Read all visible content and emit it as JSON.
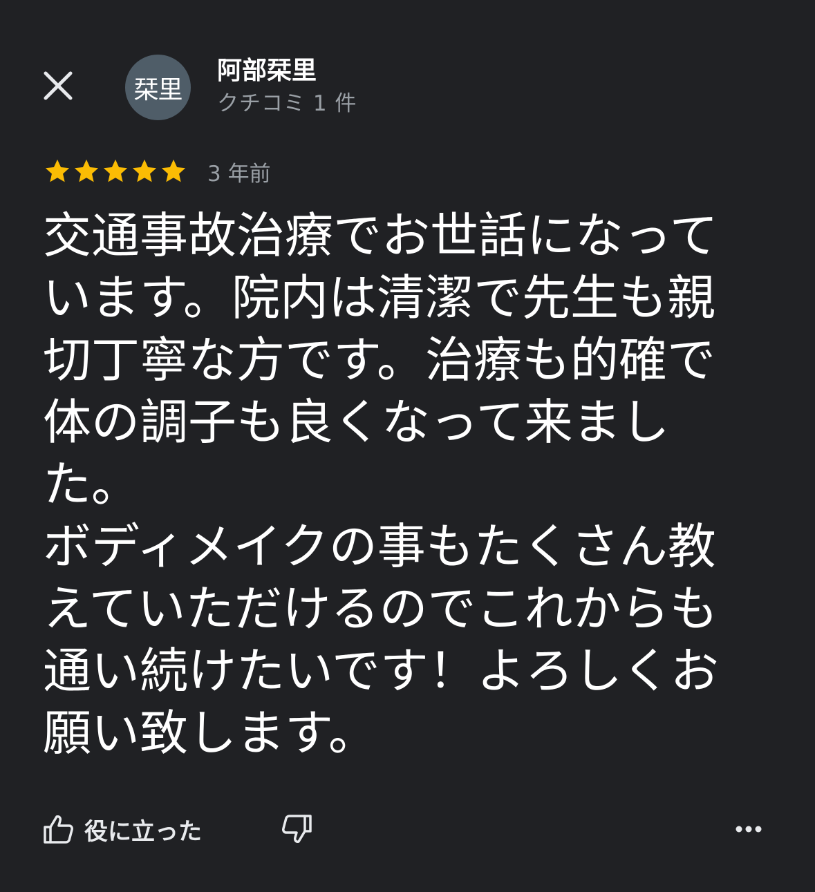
{
  "reviewer": {
    "avatar_text": "栞里",
    "name": "阿部栞里",
    "meta": "クチコミ 1 件"
  },
  "review": {
    "rating": 5,
    "star_color": "#fbbc04",
    "date": "3 年前",
    "text": "交通事故治療でお世話になっています。院内は清潔で先生も親切丁寧な方です。治療も的確で体の調子も良くなって来ました。\nボディメイクの事もたくさん教えていただけるのでこれからも通い続けたいです！よろしくお願い致します。"
  },
  "actions": {
    "helpful_label": "役に立った",
    "icons": [
      "close-icon",
      "thumbs-up-icon",
      "thumbs-down-icon",
      "more-horiz-icon"
    ]
  }
}
